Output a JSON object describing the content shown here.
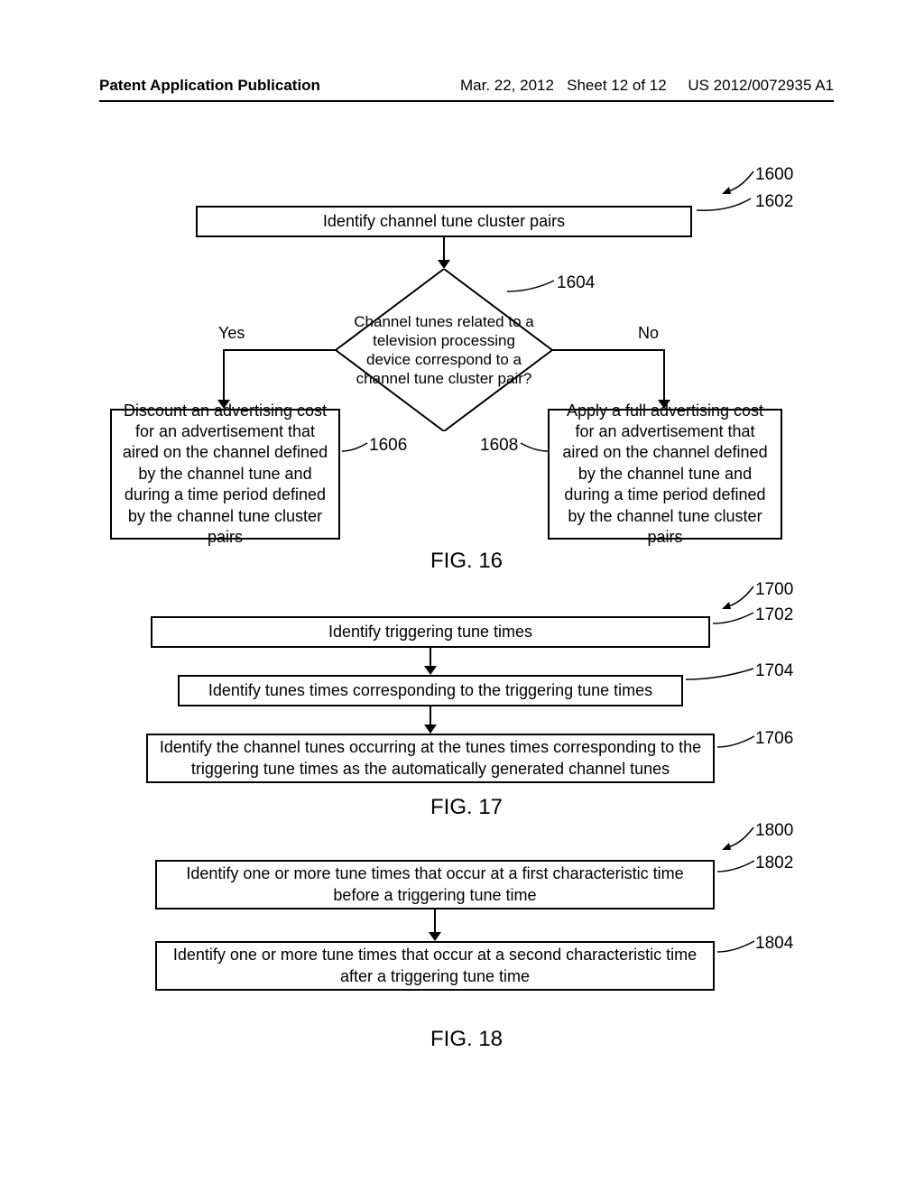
{
  "header": {
    "left": "Patent Application Publication",
    "date": "Mar. 22, 2012",
    "sheet": "Sheet 12 of 12",
    "pubnum": "US 2012/0072935 A1"
  },
  "fig16": {
    "ref_main": "1600",
    "steps": {
      "s1602": {
        "ref": "1602",
        "text": "Identify channel tune cluster pairs"
      },
      "s1604": {
        "ref": "1604",
        "text": "Channel tunes related to a television processing device correspond to a channel tune cluster pair?"
      },
      "s1606": {
        "ref": "1606",
        "text": "Discount an advertising cost for an advertisement that aired on the channel defined by the channel tune and during a time period defined by the channel tune cluster pairs"
      },
      "s1608": {
        "ref": "1608",
        "text": "Apply a full advertising cost for an advertisement that aired on the channel defined by the channel tune and during a time period defined by the channel tune cluster pairs"
      }
    },
    "yes_label": "Yes",
    "no_label": "No",
    "figure_label": "FIG. 16"
  },
  "fig17": {
    "ref_main": "1700",
    "steps": {
      "s1702": {
        "ref": "1702",
        "text": "Identify triggering tune times"
      },
      "s1704": {
        "ref": "1704",
        "text": "Identify tunes times corresponding to the triggering tune times"
      },
      "s1706": {
        "ref": "1706",
        "text": "Identify the channel tunes occurring at the tunes times corresponding to the triggering tune times as the automatically generated channel tunes"
      }
    },
    "figure_label": "FIG. 17"
  },
  "fig18": {
    "ref_main": "1800",
    "steps": {
      "s1802": {
        "ref": "1802",
        "text": "Identify one or more tune times that occur at a first characteristic time before a triggering tune time"
      },
      "s1804": {
        "ref": "1804",
        "text": "Identify one or more tune times that occur at a second characteristic time after a triggering tune time"
      }
    },
    "figure_label": "FIG. 18"
  }
}
